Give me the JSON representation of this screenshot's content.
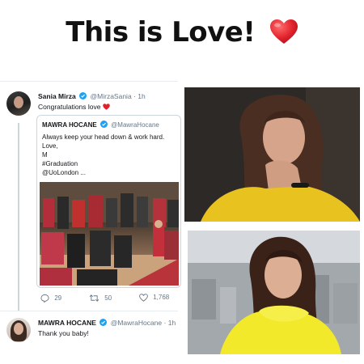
{
  "headline": {
    "text": "This is Love!",
    "heart_icon": "red-heart-emoji"
  },
  "tweet_main": {
    "name": "Sania Mirza",
    "handle": "@MirzaSania",
    "separator": "·",
    "time": "1h",
    "text": "Congratulations love",
    "emoji": "red-heart-emoji"
  },
  "quoted_tweet": {
    "name": "MAWRA HOCANE",
    "handle": "@MawraHocane",
    "lines": [
      "Always keep your head down & work hard.",
      "Love,",
      "M",
      "#Graduation",
      "@UoLondon ..."
    ]
  },
  "actions": {
    "replies": "29",
    "retweets": "50",
    "likes": "1,768"
  },
  "tweet_reply": {
    "name": "MAWRA HOCANE",
    "handle": "@MawraHocane",
    "separator": "·",
    "time": "1h",
    "text": "Thank you baby!"
  },
  "colors": {
    "verified_blue": "#1da1f2",
    "heart_red": "#e0212b",
    "meta_gray": "#657786",
    "yellow_top": "#e8c21e",
    "yellow_fur": "#f2e92a"
  }
}
